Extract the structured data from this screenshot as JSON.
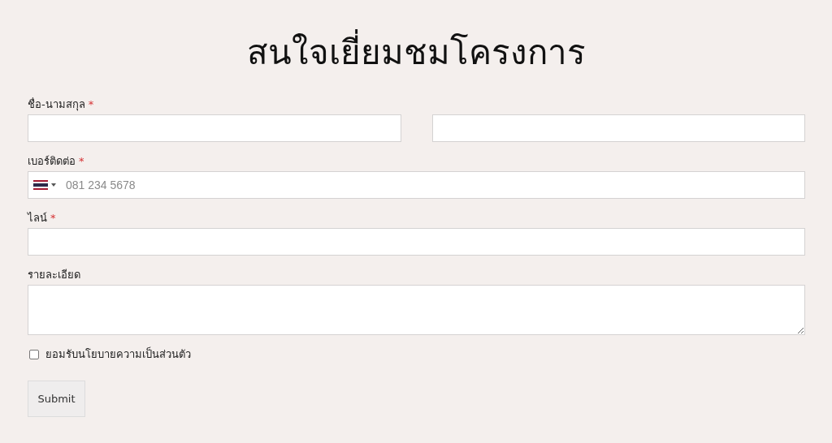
{
  "title": "สนใจเยี่ยมชมโครงการ",
  "fields": [
    {
      "kind": "split",
      "label": "ชื่อ-นามสกุล",
      "required_mark": "*"
    },
    {
      "kind": "phone",
      "label": "เบอร์ติดต่อ",
      "required_mark": "*",
      "placeholder": "081 234 5678"
    },
    {
      "kind": "text",
      "label": "ไลน์",
      "required_mark": "*"
    },
    {
      "kind": "textarea",
      "label": "รายละเอียด"
    }
  ],
  "consent": {
    "label": "ยอมรับนโยบายความเป็นส่วนตัว",
    "checked": false
  },
  "submit": "Submit"
}
